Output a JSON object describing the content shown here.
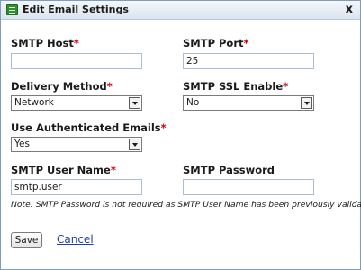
{
  "window": {
    "title": "Edit Email Settings",
    "close_label": "x"
  },
  "fields": {
    "smtp_host": {
      "label": "SMTP Host",
      "required": "*",
      "value": ""
    },
    "smtp_port": {
      "label": "SMTP Port",
      "required": "*",
      "value": "25"
    },
    "delivery_method": {
      "label": "Delivery Method",
      "required": "*",
      "value": "Network"
    },
    "ssl_enable": {
      "label": "SMTP SSL Enable",
      "required": "*",
      "value": "No"
    },
    "use_auth": {
      "label": "Use Authenticated Emails",
      "required": "*",
      "value": "Yes"
    },
    "smtp_user": {
      "label": "SMTP User Name",
      "required": "*",
      "value": "smtp.user"
    },
    "smtp_password": {
      "label": "SMTP Password",
      "value": ""
    }
  },
  "note": "Note: SMTP Password is not required as SMTP User Name has been previously validated.",
  "actions": {
    "save_label": "Save",
    "cancel_label": "Cancel"
  },
  "colors": {
    "required": "#cc0000",
    "link": "#1f3fa8"
  }
}
